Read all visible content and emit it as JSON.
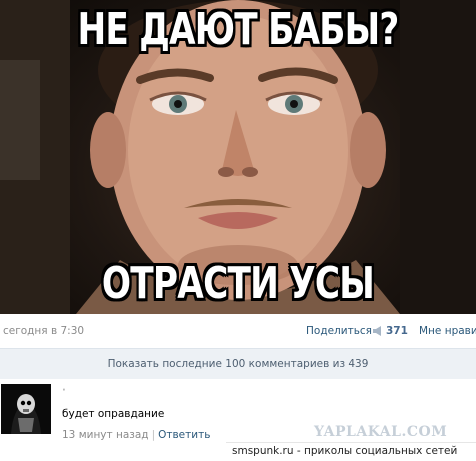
{
  "meme": {
    "top_caption": "НЕ ДАЮТ БАБЫ?",
    "bottom_caption": "ОТРАСТИ УСЫ"
  },
  "post": {
    "date": "сегодня в 7:30",
    "share_label": "Поделиться",
    "share_count": "371",
    "like_label": "Мне нравит",
    "share_icon": "megaphone-icon"
  },
  "comments_bar": {
    "label": "Показать последние 100 комментариев из 439"
  },
  "comment": {
    "text": "будет оправдание",
    "time": "13 минут назад",
    "separator": "|",
    "reply_label": "Ответить"
  },
  "watermarks": {
    "yaplakal": "YAPLAKAL.COM",
    "smspunk": "smspunk.ru - приколы социальных сетей"
  },
  "colors": {
    "link": "#2b587a",
    "muted": "#8a8a8a",
    "bar_bg": "#edf1f5"
  }
}
